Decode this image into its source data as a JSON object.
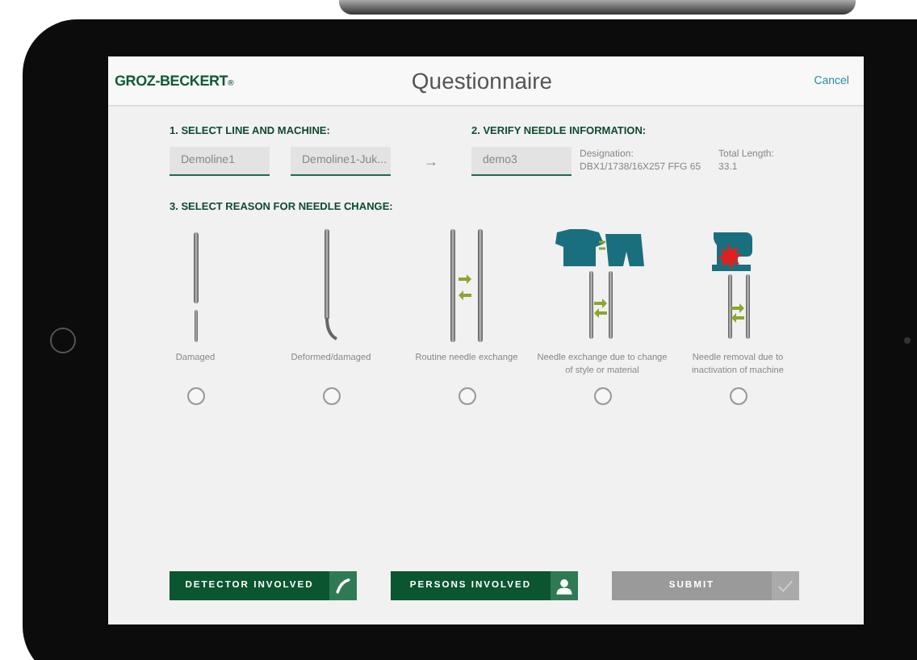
{
  "header": {
    "logo": "GROZ-BECKERT",
    "logo_mark": "®",
    "title": "Questionnaire",
    "cancel": "Cancel"
  },
  "step1": {
    "label": "1. SELECT LINE AND MACHINE:",
    "fields": [
      {
        "value": "Demoline1"
      },
      {
        "value": "Demoline1-Juk..."
      }
    ]
  },
  "arrow": "→",
  "step2": {
    "label": "2. VERIFY NEEDLE INFORMATION:",
    "field": {
      "value": "demo3"
    },
    "designation_label": "Designation:",
    "designation": "DBX1/1738/16X257 FFG 65",
    "length_label": "Total Length:",
    "length": "33.1"
  },
  "step3": {
    "label": "3. SELECT REASON FOR NEEDLE CHANGE:",
    "reasons": [
      {
        "kind": "damaged",
        "label": "Damaged",
        "selected": false
      },
      {
        "kind": "deformed",
        "label": "Deformed/damaged",
        "selected": false
      },
      {
        "kind": "routine",
        "label": "Routine needle exchange",
        "selected": false
      },
      {
        "kind": "style",
        "label": "Needle exchange due to change of style or material",
        "selected": false
      },
      {
        "kind": "machine",
        "label": "Needle removal due to inactivation of machine",
        "selected": false
      }
    ]
  },
  "buttons": [
    {
      "kind": "detector",
      "label": "DETECTOR INVOLVED",
      "disabled": false
    },
    {
      "kind": "persons",
      "label": "PERSONS INVOLVED",
      "disabled": false
    },
    {
      "kind": "submit",
      "label": "SUBMIT",
      "disabled": true
    }
  ]
}
